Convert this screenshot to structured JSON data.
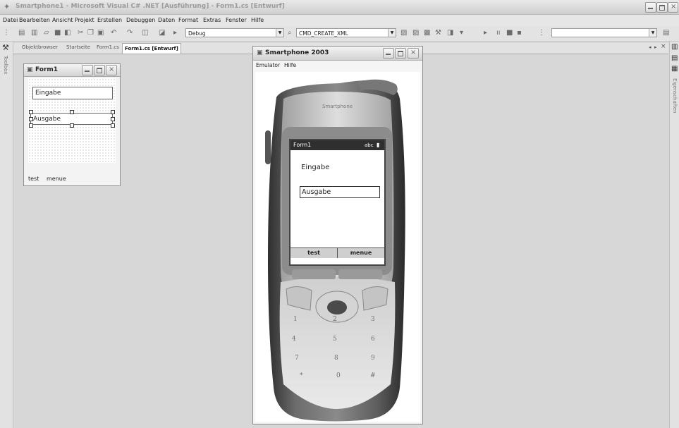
{
  "window": {
    "title": "Smartphone1 - Microsoft Visual C# .NET [Ausführung] - Form1.cs [Entwurf]"
  },
  "menubar": {
    "items": [
      "Datei",
      "Bearbeiten",
      "Ansicht",
      "Projekt",
      "Erstellen",
      "Debuggen",
      "Daten",
      "Format",
      "Extras",
      "Fenster",
      "Hilfe"
    ]
  },
  "toolbar": {
    "config_value": "Debug",
    "target_value": "CMD_CREATE_XML",
    "search_value": ""
  },
  "sidebar": {
    "toolbox_label": "Toolbox",
    "properties_label": "Eigenschaften"
  },
  "tabs": [
    "Objektbrowser",
    "Startseite",
    "Form1.cs",
    "Form1.cs [Entwurf]"
  ],
  "tab_nav": {
    "left": "◂",
    "right": "▸",
    "close": "×"
  },
  "designer": {
    "form_title": "Form1",
    "eingabe": "Eingabe",
    "ausgabe": "Ausgabe",
    "menu_left": "test",
    "menu_right": "menue"
  },
  "emulator": {
    "title": "Smartphone 2003",
    "menu": [
      "Emulator",
      "Hilfe"
    ],
    "brand": "Smartphone",
    "screen_title": "Form1",
    "screen_status": "abc",
    "eingabe": "Eingabe",
    "ausgabe": "Ausgabe",
    "softkey_left": "test",
    "softkey_right": "menue",
    "keys": [
      [
        "1",
        "2",
        "3"
      ],
      [
        "4",
        "5",
        "6"
      ],
      [
        "7",
        "8",
        "9"
      ],
      [
        "*",
        "0",
        "#"
      ]
    ]
  },
  "colors": {
    "phone_body": "#4a4a4a",
    "phone_face": "#bdbdbd",
    "screen_caption": "#2f2f2f"
  }
}
